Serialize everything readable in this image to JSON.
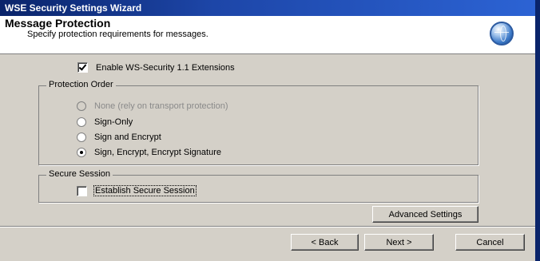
{
  "window": {
    "title": "WSE Security Settings Wizard"
  },
  "header": {
    "title": "Message Protection",
    "subtitle": "Specify protection requirements for messages.",
    "icon": "globe-icon"
  },
  "enable_ws11": {
    "label": "Enable WS-Security 1.1 Extensions",
    "checked": true
  },
  "protection_order": {
    "legend": "Protection Order",
    "options": [
      {
        "label": "None (rely on transport protection)",
        "selected": false,
        "enabled": false
      },
      {
        "label": "Sign-Only",
        "selected": false,
        "enabled": true
      },
      {
        "label": "Sign and Encrypt",
        "selected": false,
        "enabled": true
      },
      {
        "label": "Sign, Encrypt, Encrypt Signature",
        "selected": true,
        "enabled": true
      }
    ]
  },
  "secure_session": {
    "legend": "Secure Session",
    "establish": {
      "label": "Establish Secure Session",
      "checked": false
    }
  },
  "buttons": {
    "advanced": "Advanced Settings",
    "back": "< Back",
    "next": "Next >",
    "cancel": "Cancel"
  }
}
